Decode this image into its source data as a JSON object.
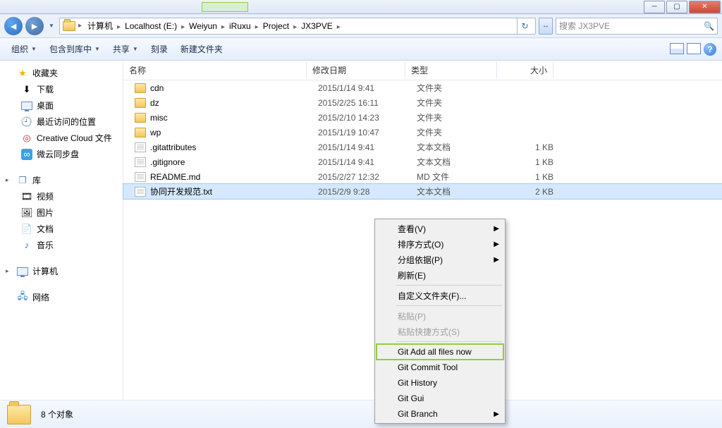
{
  "breadcrumb": [
    "计算机",
    "Localhost (E:)",
    "Weiyun",
    "iRuxu",
    "Project",
    "JX3PVE"
  ],
  "search": {
    "placeholder": "搜索 JX3PVE"
  },
  "toolbar": {
    "org": "组织",
    "lib": "包含到库中",
    "share": "共享",
    "burn": "刻录",
    "newfolder": "新建文件夹"
  },
  "sidebar": {
    "fav": {
      "head": "收藏夹",
      "items": [
        "下载",
        "桌面",
        "最近访问的位置",
        "Creative Cloud 文件",
        "微云同步盘"
      ]
    },
    "lib": {
      "head": "库",
      "items": [
        "视频",
        "图片",
        "文档",
        "音乐"
      ]
    },
    "computer": "计算机",
    "network": "网络"
  },
  "columns": {
    "name": "名称",
    "date": "修改日期",
    "type": "类型",
    "size": "大小"
  },
  "files": [
    {
      "name": "cdn",
      "date": "2015/1/14 9:41",
      "type": "文件夹",
      "size": "",
      "icon": "folder"
    },
    {
      "name": "dz",
      "date": "2015/2/25 16:11",
      "type": "文件夹",
      "size": "",
      "icon": "folder"
    },
    {
      "name": "misc",
      "date": "2015/2/10 14:23",
      "type": "文件夹",
      "size": "",
      "icon": "folder"
    },
    {
      "name": "wp",
      "date": "2015/1/19 10:47",
      "type": "文件夹",
      "size": "",
      "icon": "folder"
    },
    {
      "name": ".gitattributes",
      "date": "2015/1/14 9:41",
      "type": "文本文档",
      "size": "1 KB",
      "icon": "txt"
    },
    {
      "name": ".gitignore",
      "date": "2015/1/14 9:41",
      "type": "文本文档",
      "size": "1 KB",
      "icon": "txt"
    },
    {
      "name": "README.md",
      "date": "2015/2/27 12:32",
      "type": "MD 文件",
      "size": "1 KB",
      "icon": "txt"
    },
    {
      "name": "协同开发规范.txt",
      "date": "2015/2/9 9:28",
      "type": "文本文档",
      "size": "2 KB",
      "icon": "txt",
      "selected": true
    }
  ],
  "status": {
    "count": "8 个对象"
  },
  "ctx": {
    "view": "查看(V)",
    "sort": "排序方式(O)",
    "group": "分组依据(P)",
    "refresh": "刷新(E)",
    "customize": "自定义文件夹(F)...",
    "paste": "粘贴(P)",
    "pasteShortcut": "粘贴快捷方式(S)",
    "gitAdd": "Git Add all files now",
    "gitCommit": "Git Commit Tool",
    "gitHistory": "Git History",
    "gitGui": "Git Gui",
    "gitBranch": "Git Branch"
  }
}
